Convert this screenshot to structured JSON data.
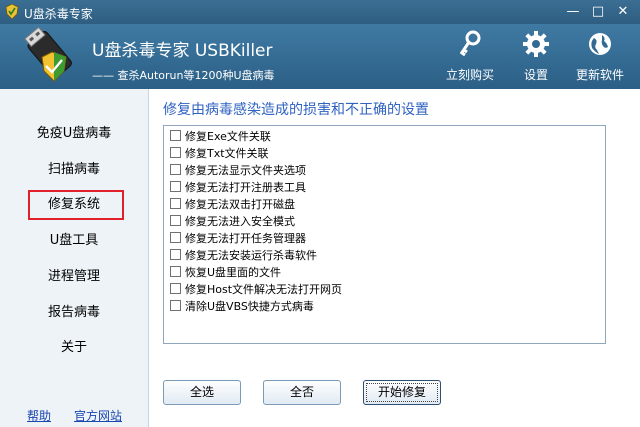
{
  "window": {
    "title": "U盘杀毒专家",
    "controls": {
      "minimize": "—",
      "maximize": "□",
      "close": "✕"
    }
  },
  "header": {
    "app_name": "U盘杀毒专家  USBKiller",
    "slogan": "—— 查杀Autorun等1200种U盘病毒",
    "tools": [
      {
        "label": "立刻购买",
        "icon": "key-icon"
      },
      {
        "label": "设置",
        "icon": "gear-icon"
      },
      {
        "label": "更新软件",
        "icon": "globe-icon"
      }
    ]
  },
  "sidebar": {
    "items": [
      {
        "label": "免疫U盘病毒"
      },
      {
        "label": "扫描病毒"
      },
      {
        "label": "修复系统",
        "selected": true
      },
      {
        "label": "U盘工具"
      },
      {
        "label": "进程管理"
      },
      {
        "label": "报告病毒"
      },
      {
        "label": "关于"
      }
    ],
    "help_link": "帮助",
    "website_link": "官方网站"
  },
  "main": {
    "section_title": "修复由病毒感染造成的损害和不正确的设置",
    "options": [
      {
        "label": "修复Exe文件关联",
        "checked": false
      },
      {
        "label": "修复Txt文件关联",
        "checked": false
      },
      {
        "label": "修复无法显示文件夹选项",
        "checked": false
      },
      {
        "label": "修复无法打开注册表工具",
        "checked": false
      },
      {
        "label": "修复无法双击打开磁盘",
        "checked": false
      },
      {
        "label": "修复无法进入安全模式",
        "checked": false
      },
      {
        "label": "修复无法打开任务管理器",
        "checked": false
      },
      {
        "label": "修复无法安装运行杀毒软件",
        "checked": false
      },
      {
        "label": "恢复U盘里面的文件",
        "checked": false
      },
      {
        "label": "修复Host文件解决无法打开网页",
        "checked": false
      },
      {
        "label": "清除U盘VBS快捷方式病毒",
        "checked": false
      }
    ],
    "buttons": {
      "select_all": "全选",
      "select_none": "全否",
      "start_repair": "开始修复"
    }
  },
  "colors": {
    "header_bg": "#336a92",
    "title_accent": "#2f62c2",
    "selection_outline": "#e0202a",
    "link": "#1a46b0"
  }
}
